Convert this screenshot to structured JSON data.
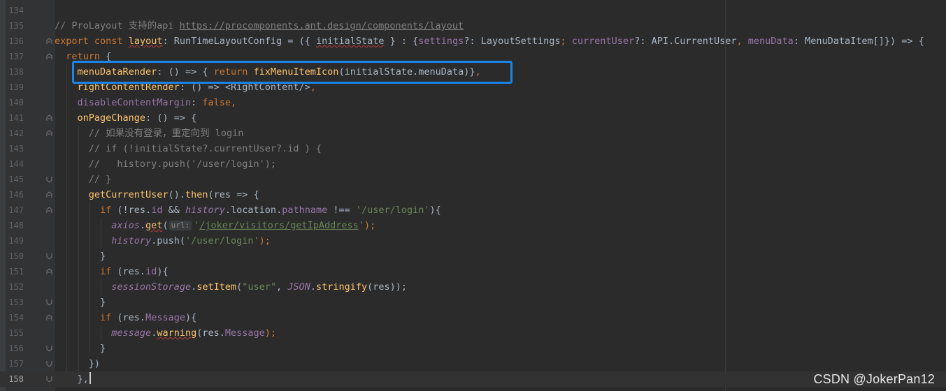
{
  "editor": {
    "theme": "darcula",
    "current_line": 158,
    "colors": {
      "background": "#2b2b2b",
      "gutter": "#313335",
      "keyword": "#cc7832",
      "function": "#ffc66d",
      "property": "#9876aa",
      "string": "#6a8759",
      "comment": "#808080",
      "highlight_box": "#1b84e8"
    },
    "line_numbers": [
      "134",
      "135",
      "136",
      "137",
      "138",
      "139",
      "140",
      "141",
      "142",
      "143",
      "144",
      "145",
      "146",
      "147",
      "148",
      "149",
      "150",
      "151",
      "152",
      "153",
      "154",
      "155",
      "156",
      "157",
      "158"
    ],
    "param_hint": "url:"
  },
  "code": {
    "l135_comment": "// ProLayout 支持的api ",
    "l135_link": "https://procomponents.ant.design/components/layout",
    "l136_export": "export",
    "l136_const": "const",
    "l136_layout": "layout",
    "l136_type": "RunTimeLayoutConfig",
    "l136_eq_open": " = ({ ",
    "l136_initial_state": "initialState",
    "l136_mid1": " } : {",
    "l136_settings": "settings",
    "l136_mid2": "?: LayoutSettings",
    "l136_semi1": ";",
    "l136_current_user": "currentUser",
    "l136_mid3": "?: API.CurrentUser",
    "l136_comma": ",",
    "l136_menu_data": "menuData",
    "l136_tail": ": MenuDataItem[]}) => {",
    "l137_return": "return",
    "l137_brace": " {",
    "l138_menu_data_render": "menuDataRender",
    "l138_mid": ": () => { ",
    "l138_return": "return",
    "l138_fn": "fixMenuItemIcon",
    "l138_args": "(initialState.menuData)}",
    "l138_comma": ",",
    "l139_right_content_render": "rightContentRender",
    "l139_tail": ": () => <RightContent/>",
    "l139_comma": ",",
    "l140_disable_content_margin": "disableContentMargin",
    "l140_colon": ": ",
    "l140_false": "false",
    "l140_comma": ",",
    "l141_on_page_change": "onPageChange",
    "l141_tail": ": () => {",
    "l142_comment": "// 如果没有登录，重定向到 login",
    "l143_comment": "// if (!initialState?.currentUser?.id ) {",
    "l144_comment": "//   history.push('/user/login');",
    "l145_comment": "// }",
    "l146_fn1": "getCurrentUser",
    "l146_mid": "().",
    "l146_then": "then",
    "l146_tail": "(res => {",
    "l147_if": "if",
    "l147_a": " (!res.",
    "l147_id": "id",
    "l147_b": " && ",
    "l147_history": "history",
    "l147_c": ".",
    "l147_location": "location",
    "l147_d": ".",
    "l147_pathname": "pathname",
    "l147_e": " !== ",
    "l147_str": "'/user/login'",
    "l147_f": "){",
    "l148_axios": "axios",
    "l148_dot": ".",
    "l148_get": "get",
    "l148_paren": "(",
    "l148_q1": "'",
    "l148_url": "/joker/visitors/getIpAddress",
    "l148_q2": "'",
    "l148_end": ");",
    "l149_history": "history",
    "l149_push": ".push(",
    "l149_str": "'/user/login'",
    "l149_end": ");",
    "l150_text": "}",
    "l151_if": "if",
    "l151_a": " (res.",
    "l151_id": "id",
    "l151_b": "){",
    "l152_session_storage": "sessionStorage",
    "l152_dot": ".",
    "l152_set_item": "setItem",
    "l152_paren": "(",
    "l152_str": "\"user\"",
    "l152_comma": ", ",
    "l152_json": "JSON",
    "l152_dot2": ".",
    "l152_stringify": "stringify",
    "l152_end": "(res));",
    "l153_text": "}",
    "l154_if": "if",
    "l154_a": " (res.",
    "l154_message": "Message",
    "l154_b": "){",
    "l155_message": "message",
    "l155_dot": ".",
    "l155_warning": "warning",
    "l155_a": "(res.",
    "l155_msg": "Message",
    "l155_end": ");",
    "l156_text": "}",
    "l157_text": "})",
    "l158_text": "},"
  },
  "watermark": "CSDN @JokerPan12"
}
